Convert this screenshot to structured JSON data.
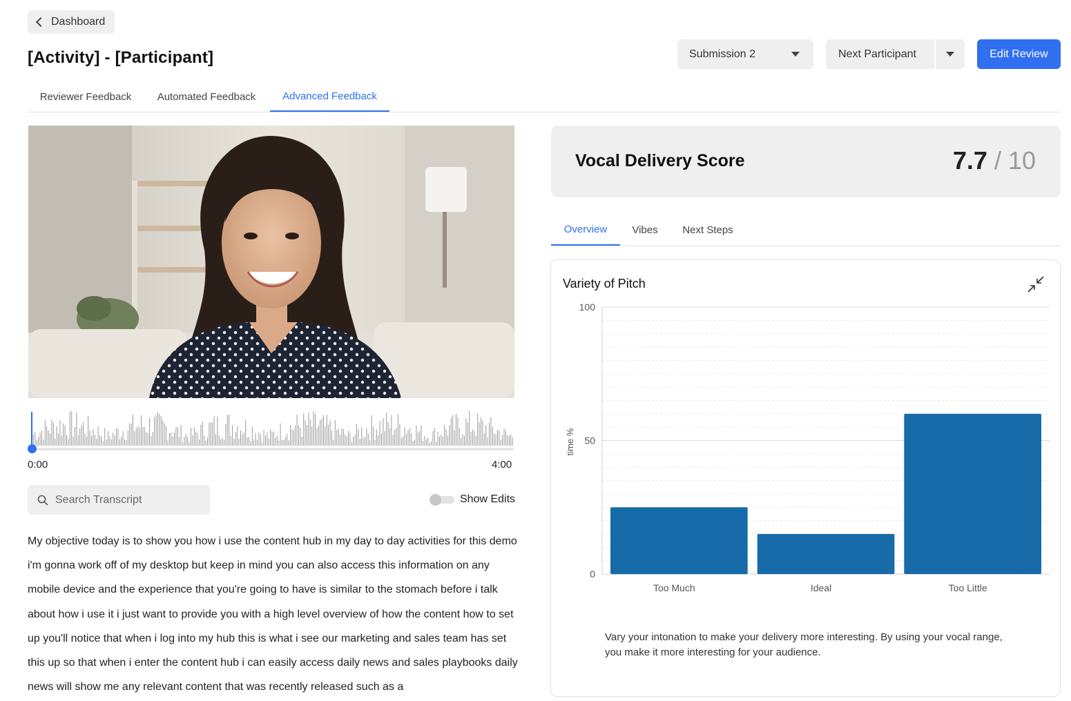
{
  "header": {
    "back_label": "Dashboard",
    "title": "[Activity] - [Participant]",
    "submission_select": "Submission 2",
    "next_participant": "Next Participant",
    "edit_review": "Edit Review"
  },
  "main_tabs": [
    {
      "label": "Reviewer Feedback",
      "active": false
    },
    {
      "label": "Automated Feedback",
      "active": false
    },
    {
      "label": "Advanced Feedback",
      "active": true
    }
  ],
  "player": {
    "time_start": "0:00",
    "time_end": "4:00",
    "progress": 0
  },
  "transcript_tools": {
    "search_placeholder": "Search Transcript",
    "show_edits_label": "Show Edits",
    "show_edits_on": false
  },
  "transcript": {
    "text": "My objective today is to show you how i use the content hub in my day to day activities for this demo i'm gonna work off of my desktop but keep in mind you can also access this information on any mobile device and the experience that you're going to have is similar to the stomach before i talk about how i use it i just want to provide you with a high level overview of how the content how to set up you'll notice that when i log into my hub this is what i see our marketing and sales team has set this up so that when i enter the content hub i can easily access daily news and sales playbooks daily news will show me any relevant content that was recently released such as a"
  },
  "score": {
    "title": "Vocal Delivery Score",
    "value": "7.7",
    "max": "/ 10"
  },
  "sub_tabs": [
    {
      "label": "Overview",
      "active": true
    },
    {
      "label": "Vibes",
      "active": false
    },
    {
      "label": "Next Steps",
      "active": false
    }
  ],
  "chart_card": {
    "title": "Variety of Pitch",
    "note": "Vary your intonation to make your delivery more interesting. By using your vocal range, you make it more interesting for your audience."
  },
  "chart_data": {
    "type": "bar",
    "title": "Variety of Pitch",
    "categories": [
      "Too Much",
      "Ideal",
      "Too Little"
    ],
    "values": [
      25,
      15,
      60
    ],
    "xlabel": "",
    "ylabel": "time %",
    "ylim": [
      0,
      100
    ],
    "yticks": [
      0,
      50,
      100
    ],
    "grid": true,
    "bar_color": "#176ba8"
  },
  "colors": {
    "accent": "#2f6ff0",
    "bar": "#176ba8"
  }
}
